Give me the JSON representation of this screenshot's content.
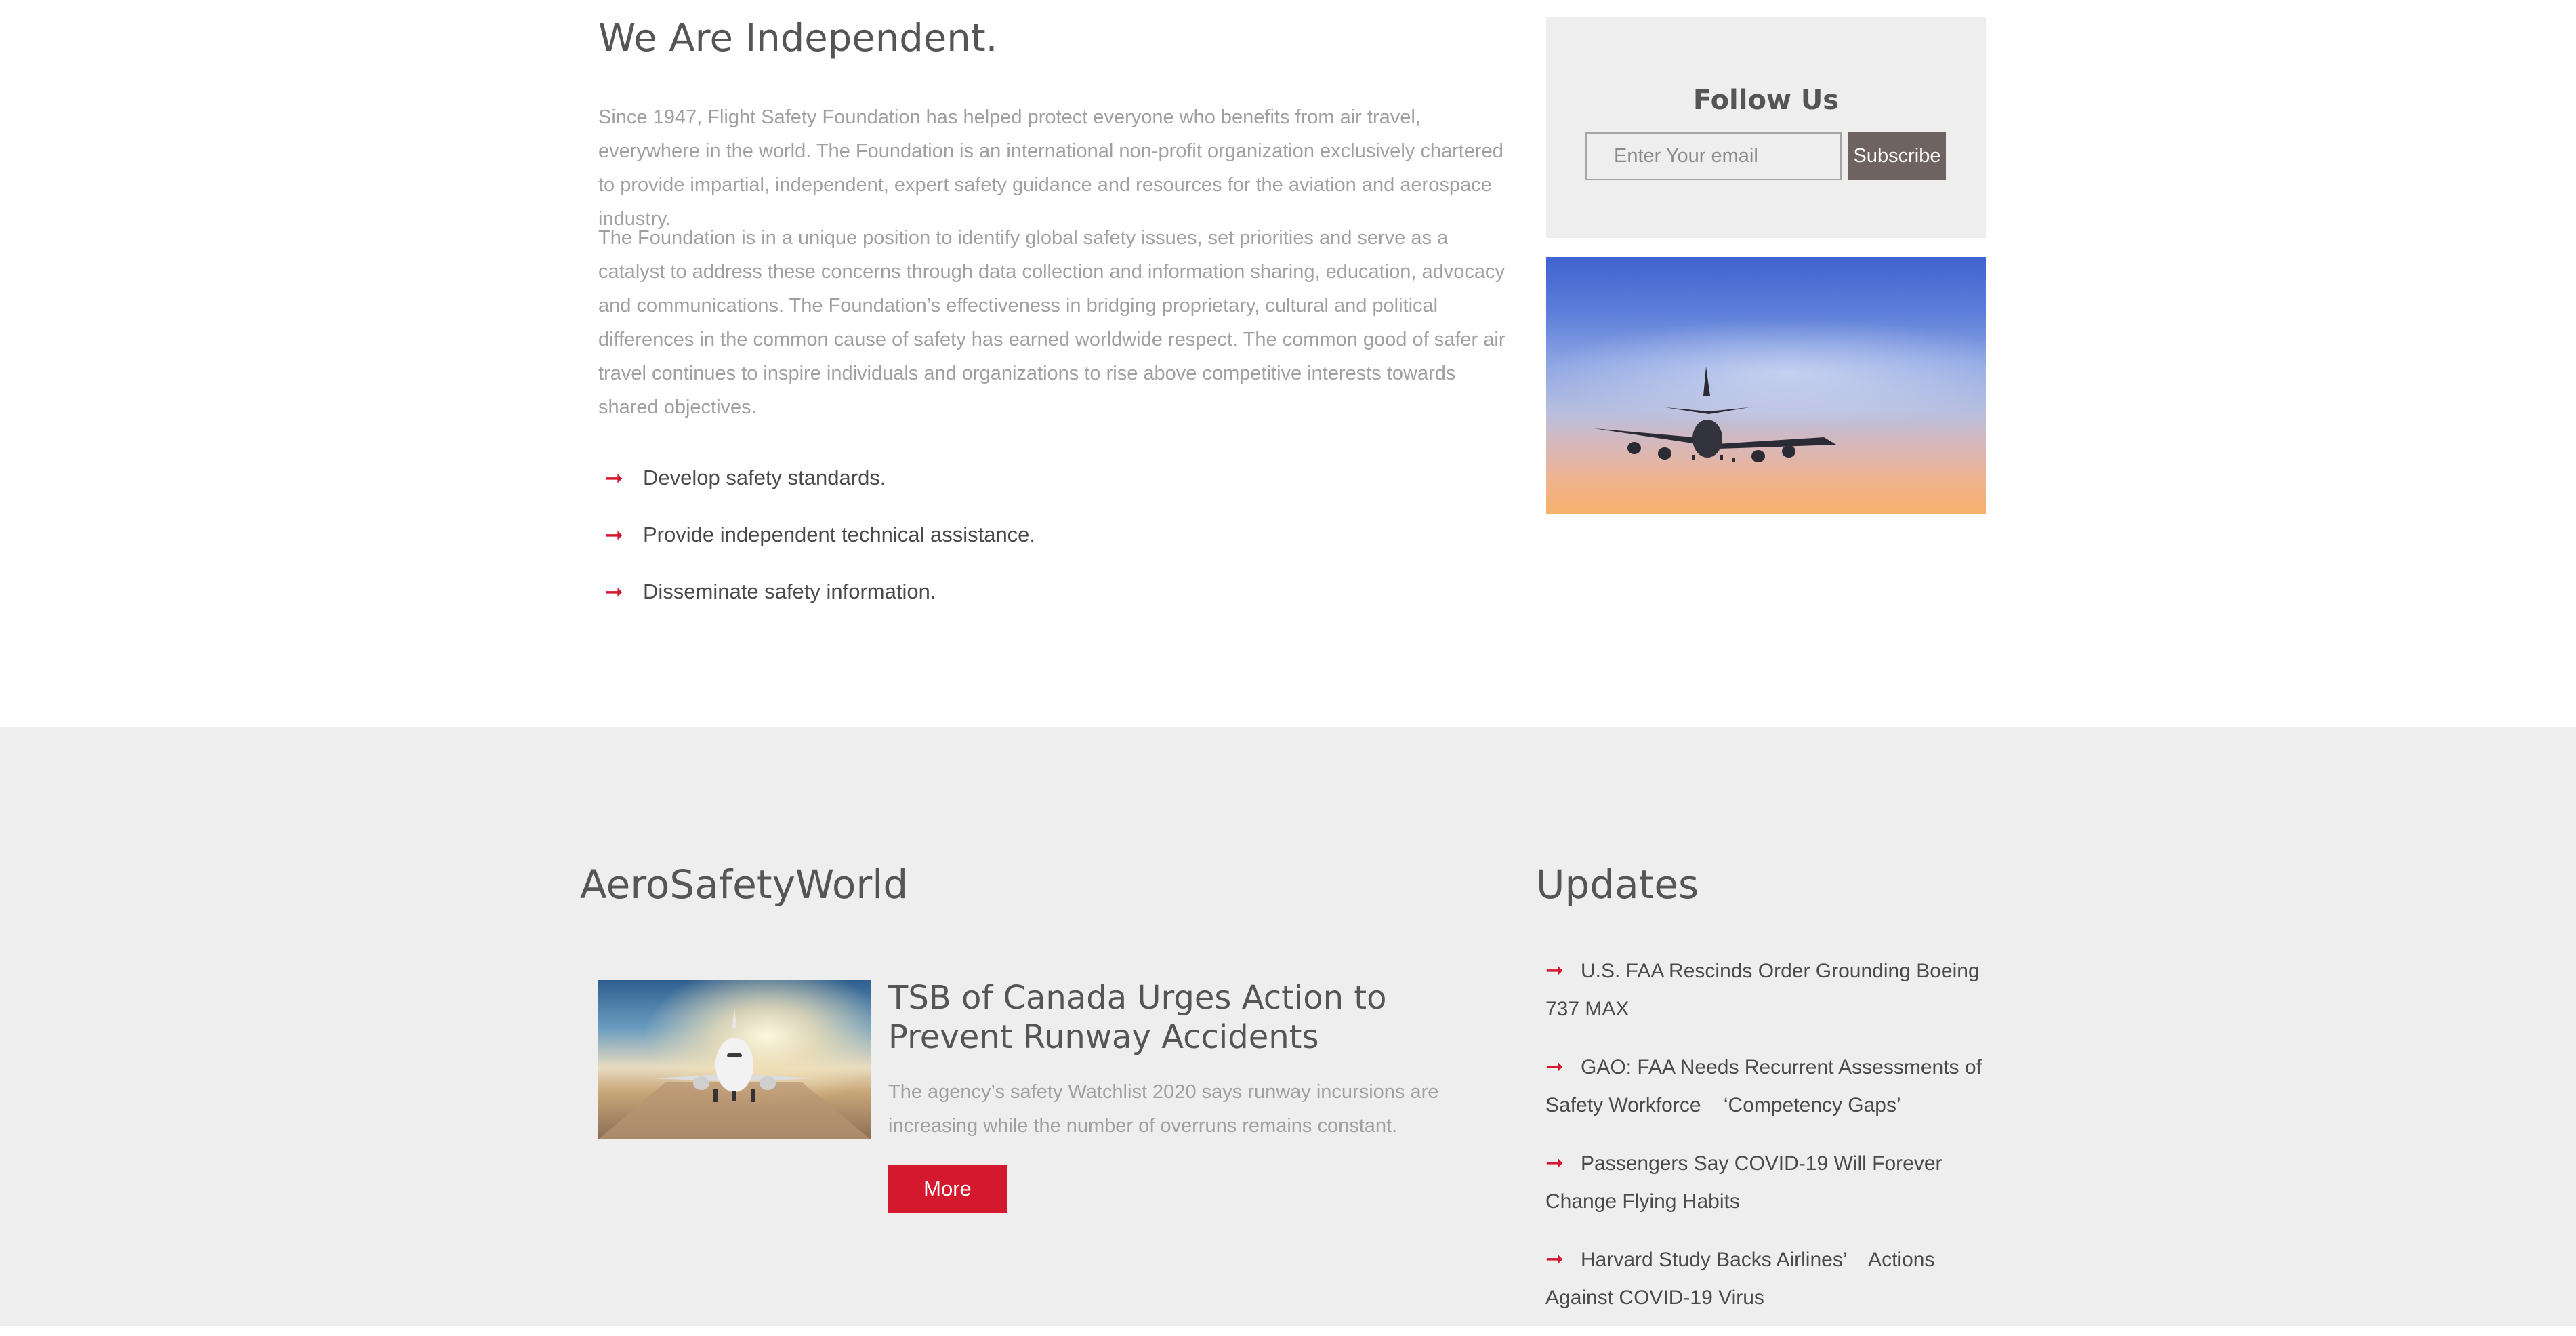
{
  "about": {
    "title": "We Are Independent.",
    "paragraph_1": "Since 1947, Flight Safety Foundation has helped protect everyone who benefits from air travel, everywhere in the world. The Foundation is an international non-profit organization exclusively chartered to provide impartial, independent, expert safety guidance and resources for the aviation and aerospace industry.",
    "paragraph_2": "The Foundation is in a unique position to identify global safety issues, set priorities and serve as a catalyst to address these concerns through data collection and information sharing, education, advocacy and communications. The Foundation’s effectiveness in bridging proprietary, cultural and political differences in the common cause of safety has earned worldwide respect. The common good of safer air travel continues to inspire individuals and organizations to rise above competitive interests towards shared objectives.",
    "bullets": [
      "Develop safety standards.",
      "Provide independent technical assistance.",
      "Disseminate safety information."
    ],
    "bullet_icon": "arrow-right-icon"
  },
  "follow": {
    "title": "Follow Us",
    "email_placeholder": "Enter Your email",
    "email_value": "",
    "subscribe_label": "Subscribe"
  },
  "asw": {
    "title": "AeroSafetyWorld",
    "article": {
      "title": "TSB of Canada Urges Action to Prevent Runway Accidents",
      "summary": "The agency’s safety Watchlist 2020 says runway incursions are increasing while the number of overruns remains constant.",
      "more_label": "More"
    }
  },
  "updates": {
    "title": "Updates",
    "items": [
      "U.S. FAA Rescinds Order Grounding Boeing 737 MAX",
      "GAO: FAA Needs Recurrent Assessments of Safety Workforce    ‘Competency Gaps’",
      "Passengers Say COVID-19 Will Forever Change Flying Habits",
      "Harvard Study Backs Airlines’    Actions Against COVID-19 Virus"
    ]
  },
  "colors": {
    "accent_red": "#d4182d",
    "heading_gray": "#555555",
    "body_gray": "#a0a0a0",
    "panel_gray": "#eeeeee",
    "subscribe_button": "#6e6361"
  }
}
